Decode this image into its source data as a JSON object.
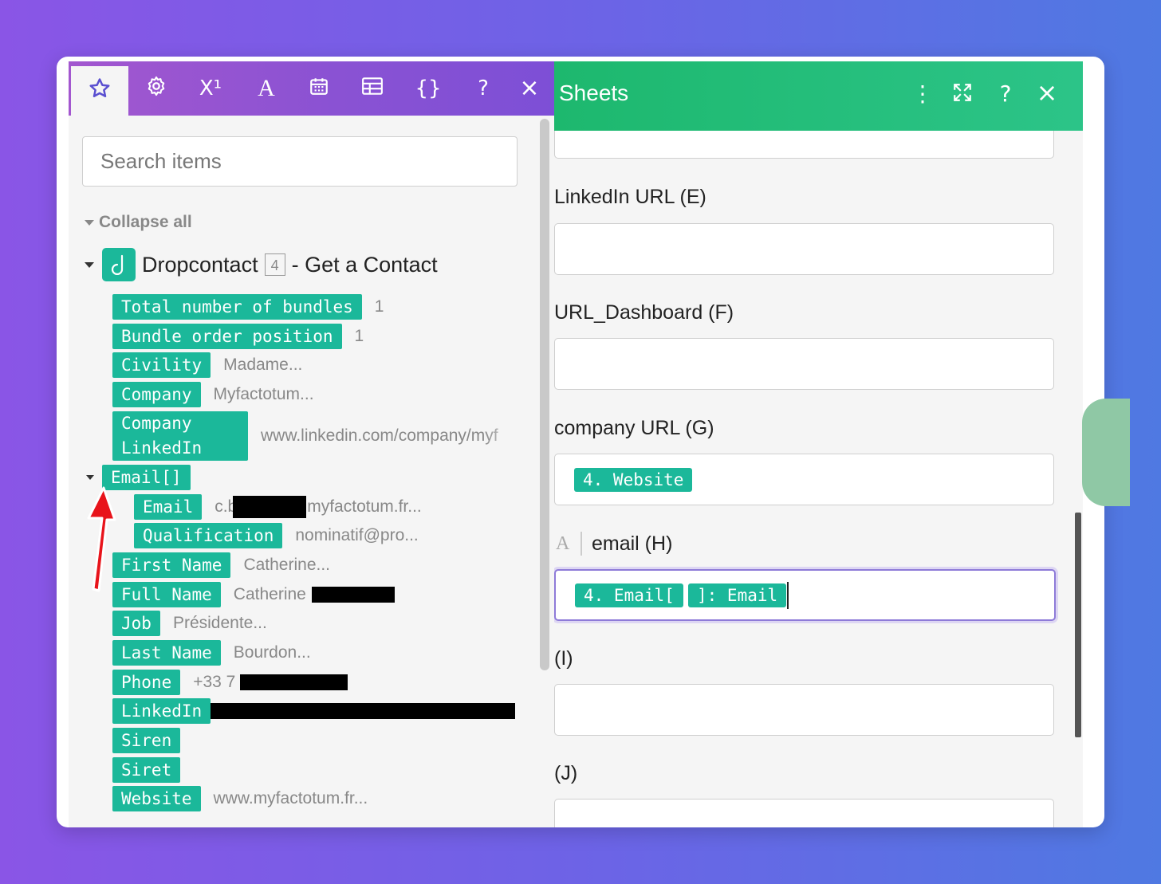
{
  "toolbar": {
    "tabs": [
      {
        "icon": "star-icon",
        "glyph": "☆"
      },
      {
        "icon": "gear-icon",
        "glyph": "⚙"
      },
      {
        "icon": "superscript-icon",
        "glyph": "X¹"
      },
      {
        "icon": "text-icon",
        "glyph": "A"
      },
      {
        "icon": "calendar-icon",
        "glyph": "▦"
      },
      {
        "icon": "table-icon",
        "glyph": "▤"
      },
      {
        "icon": "braces-icon",
        "glyph": "{}"
      }
    ],
    "help_glyph": "?",
    "close_glyph": "×"
  },
  "search": {
    "placeholder": "Search items"
  },
  "tree": {
    "collapse_all": "Collapse all",
    "module_name": "Dropcontact",
    "module_badge": "4",
    "module_action": "- Get a Contact",
    "items": [
      {
        "label": "Total number of bundles",
        "value": "1"
      },
      {
        "label": "Bundle order position",
        "value": "1"
      },
      {
        "label": "Civility",
        "value": "Madame..."
      },
      {
        "label": "Company",
        "value": "Myfactotum..."
      },
      {
        "label": "Company LinkedIn",
        "value": "www.linkedin.com/company/myf"
      },
      {
        "label": "Email[]",
        "value": ""
      },
      {
        "label": "Email",
        "value": "c.b",
        "value_suffix": "myfactotum.fr..."
      },
      {
        "label": "Qualification",
        "value": "nominatif@pro..."
      },
      {
        "label": "First Name",
        "value": "Catherine..."
      },
      {
        "label": "Full Name",
        "value": "Catherine"
      },
      {
        "label": "Job",
        "value": "Présidente..."
      },
      {
        "label": "Last Name",
        "value": "Bourdon..."
      },
      {
        "label": "Phone",
        "value": "+33 7"
      },
      {
        "label": "LinkedIn",
        "value": ""
      },
      {
        "label": "Siren",
        "value": ""
      },
      {
        "label": "Siret",
        "value": ""
      },
      {
        "label": "Website",
        "value": "www.myfactotum.fr..."
      }
    ]
  },
  "sheets": {
    "title": "Sheets",
    "more_glyph": "⋮",
    "expand_glyph": "⤢",
    "help_glyph": "?",
    "close_glyph": "×",
    "fields": [
      {
        "label": "LinkedIn URL (E)"
      },
      {
        "label": "URL_Dashboard (F)"
      },
      {
        "label": "company URL (G)",
        "tags": [
          "4. Website"
        ]
      },
      {
        "label": "email (H)",
        "type_glyph": "A",
        "tags": [
          "4. Email[",
          "]: Email"
        ]
      },
      {
        "label": "(I)"
      },
      {
        "label": "(J)"
      }
    ]
  },
  "colors": {
    "pill": "#1bb89a",
    "toolbar_purple": "#8a52d3",
    "sheets_green": "#1db86e",
    "annotation_arrow": "#e8141b"
  }
}
